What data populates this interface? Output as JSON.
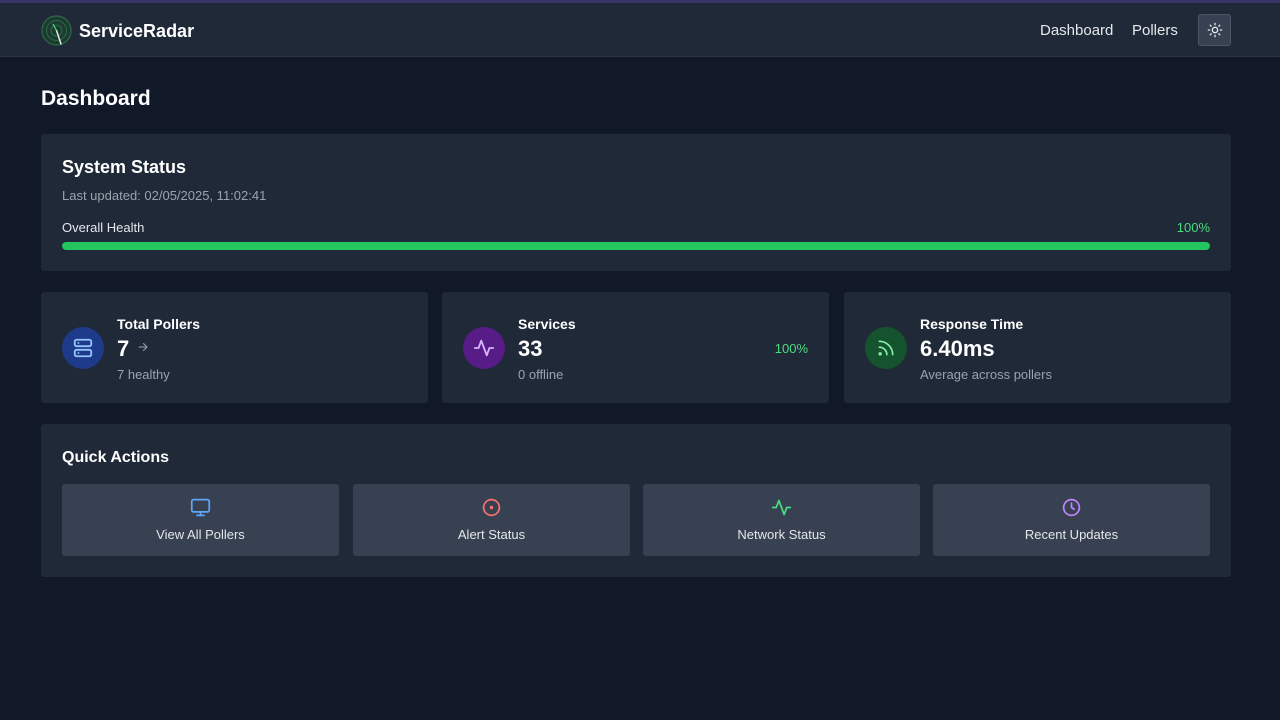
{
  "app": {
    "brand": "ServiceRadar"
  },
  "nav": {
    "items": [
      {
        "label": "Dashboard"
      },
      {
        "label": "Pollers"
      }
    ],
    "theme_toggle_icon": "sun-icon"
  },
  "page": {
    "title": "Dashboard"
  },
  "system_status": {
    "title": "System Status",
    "last_updated": "Last updated: 02/05/2025, 11:02:41",
    "health_label": "Overall Health",
    "health_value": "100%",
    "health_fraction": 1.0,
    "health_color": "#22c55e"
  },
  "stats": {
    "pollers": {
      "title": "Total Pollers",
      "value": "7",
      "sub": "7 healthy",
      "icon": "server-icon",
      "icon_bg": "#1e3a8a",
      "icon_color": "#93c5fd"
    },
    "services": {
      "title": "Services",
      "value": "33",
      "sub": "0 offline",
      "percent": "100%",
      "icon": "activity-icon",
      "icon_bg": "#581c87",
      "icon_color": "#d8b4fe"
    },
    "response": {
      "title": "Response Time",
      "value": "6.40ms",
      "sub": "Average across pollers",
      "icon": "rss-icon",
      "icon_bg": "#14532d",
      "icon_color": "#86efac"
    }
  },
  "quick_actions": {
    "title": "Quick Actions",
    "items": [
      {
        "label": "View All Pollers",
        "icon": "monitor-icon",
        "color": "#60a5fa"
      },
      {
        "label": "Alert Status",
        "icon": "alert-circle-icon",
        "color": "#f87171"
      },
      {
        "label": "Network Status",
        "icon": "activity-icon",
        "color": "#4ade80"
      },
      {
        "label": "Recent Updates",
        "icon": "clock-icon",
        "color": "#c084fc"
      }
    ]
  }
}
